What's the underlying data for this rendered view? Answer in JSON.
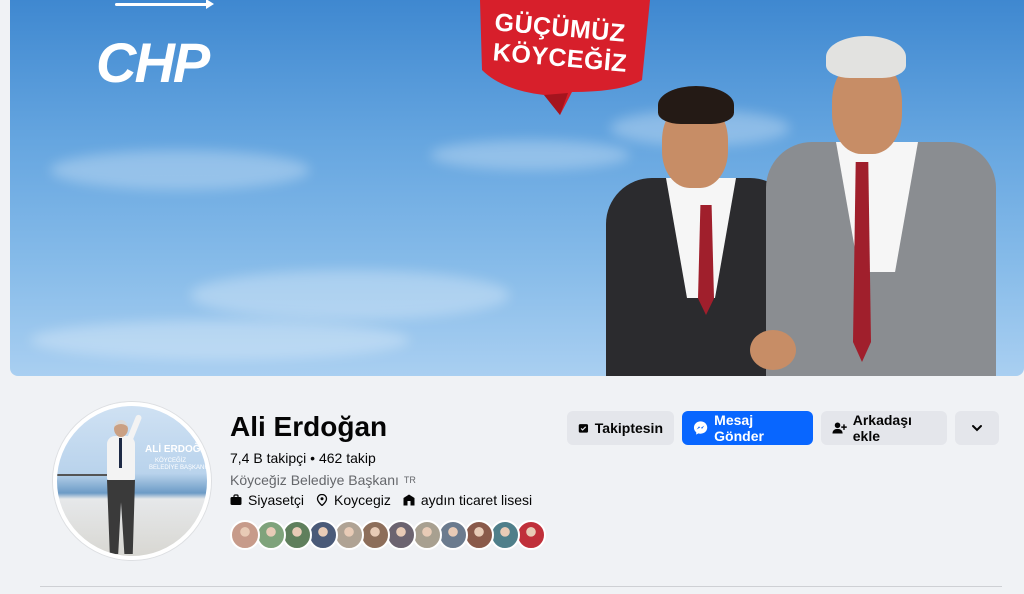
{
  "cover": {
    "party_logo": "CHP",
    "ribbon_line1": "GÜÇÜMÜZ",
    "ribbon_line2": "KÖYCEĞİZ",
    "colors": {
      "sky": "#5e9fdc",
      "ribbon": "#d71f2b"
    }
  },
  "profile": {
    "avatar_name": "ALİ ERDOĞAN",
    "avatar_subtitle_1": "KÖYCEĞİZ",
    "avatar_subtitle_2": "BELEDİYE BAŞKANI",
    "name": "Ali Erdoğan",
    "followers": "7,4 B takipçi",
    "separator": "•",
    "following": "462 takip",
    "bio": "Köyceğiz Belediye Başkanı",
    "bio_flag": "TR",
    "occupation": "Siyasetçi",
    "location": "Koycegiz",
    "education": "aydın ticaret lisesi"
  },
  "actions": {
    "follow_label": "Takiptesin",
    "message_label": "Mesaj Gönder",
    "add_friend_label": "Arkadaşı ekle",
    "more_icon": "chevron-down-icon",
    "colors": {
      "primary": "#0866ff",
      "secondary": "#e4e6eb"
    }
  },
  "mutual_friends": [
    {
      "color": "#c79b8a"
    },
    {
      "color": "#7fa37b"
    },
    {
      "color": "#5f7f5c"
    },
    {
      "color": "#4a5a78"
    },
    {
      "color": "#b0a394"
    },
    {
      "color": "#8d6e5a"
    },
    {
      "color": "#6c6470"
    },
    {
      "color": "#a8a090"
    },
    {
      "color": "#6b7b8e"
    },
    {
      "color": "#8a5a4a"
    },
    {
      "color": "#4f7f8a"
    },
    {
      "color": "#c0303a"
    }
  ]
}
